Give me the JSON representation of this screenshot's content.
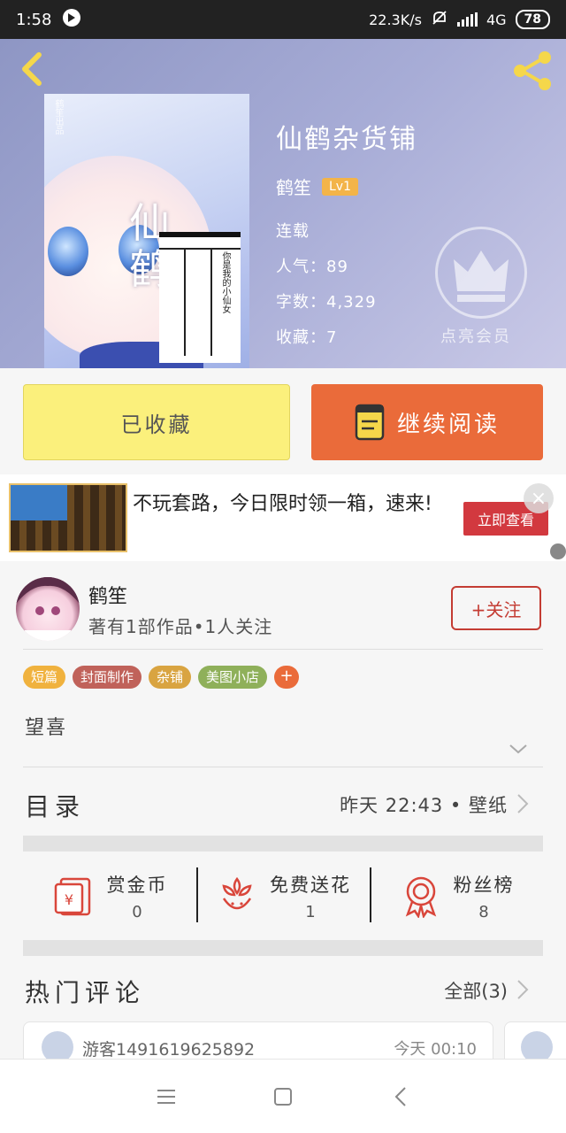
{
  "status_bar": {
    "time": "1:58",
    "net_speed": "22.3K/s",
    "network": "4G",
    "battery": "78"
  },
  "book": {
    "title": "仙鹤杂货铺",
    "author": "鹤笙",
    "level": "Lv1",
    "status": "连载",
    "popularity": "人气：89",
    "word_count": "字数：4,329",
    "favorites": "收藏：7",
    "cover": {
      "big_text": "仙\n鹤",
      "paper_text": "你是我的小仙女",
      "top_mark": "鹤笙出品"
    }
  },
  "vip": {
    "label": "点亮会员"
  },
  "actions": {
    "collected_label": "已收藏",
    "continue_label": "继续阅读"
  },
  "ad": {
    "text": "不玩套路，今日限时领一箱，速来!",
    "button": "立即查看",
    "close": "×"
  },
  "author_card": {
    "name": "鹤笙",
    "stats": "著有1部作品•1人关注",
    "follow_label": "+关注"
  },
  "tags": [
    {
      "label": "短篇",
      "color": "#f0b23e"
    },
    {
      "label": "封面制作",
      "color": "#c0625a"
    },
    {
      "label": "杂铺",
      "color": "#d9a441"
    },
    {
      "label": "美图小店",
      "color": "#8fb05a"
    }
  ],
  "tag_more": "+",
  "description": "望喜",
  "toc": {
    "title": "目录",
    "latest": "昨天 22:43 • 壁纸"
  },
  "gifts": [
    {
      "label": "赏金币",
      "value": "0",
      "icon": "coin-envelope-icon"
    },
    {
      "label": "免费送花",
      "value": "1",
      "icon": "flower-icon"
    },
    {
      "label": "粉丝榜",
      "value": "8",
      "icon": "medal-icon"
    }
  ],
  "hot_comments": {
    "title": "热门评论",
    "all_label": "全部(3)",
    "items": [
      {
        "user": "游客1491619625892",
        "time": "今天 00:10"
      }
    ]
  },
  "colors": {
    "accent_orange": "#ea6b3a",
    "collected_yellow": "#fbf07c",
    "follow_red": "#c43c33",
    "icon_yellow": "#f5d74a"
  }
}
